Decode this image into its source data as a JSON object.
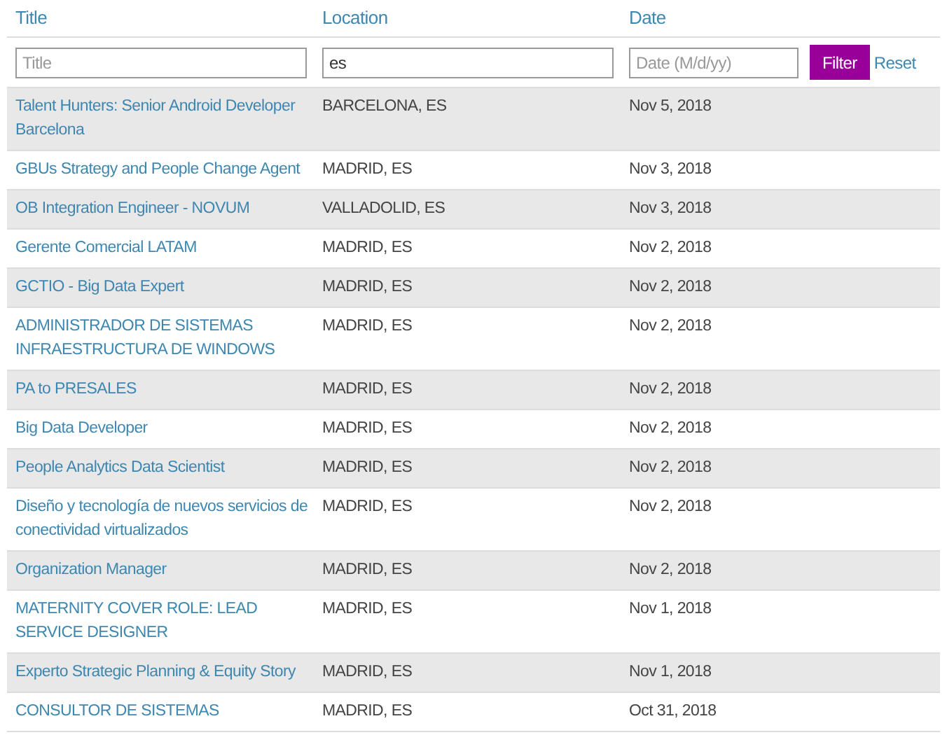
{
  "columns": [
    "Title",
    "Location",
    "Date"
  ],
  "filters": [
    {
      "placeholder": "Title"
    },
    {
      "value": "es"
    },
    {
      "placeholder": "Date (M/d/yy)"
    }
  ],
  "buttons": {
    "filter": "Filter",
    "reset": "Reset"
  },
  "rows": [
    {
      "title": "Talent Hunters: Senior Android Developer Barcelona",
      "location": "BARCELONA, ES",
      "date": "Nov 5, 2018"
    },
    {
      "title": "GBUs Strategy and People Change Agent",
      "location": "MADRID, ES",
      "date": "Nov 3, 2018"
    },
    {
      "title": "OB Integration Engineer - NOVUM",
      "location": "VALLADOLID, ES",
      "date": "Nov 3, 2018"
    },
    {
      "title": "Gerente Comercial LATAM",
      "location": "MADRID, ES",
      "date": "Nov 2, 2018"
    },
    {
      "title": "GCTIO - Big Data Expert",
      "location": "MADRID, ES",
      "date": "Nov 2, 2018"
    },
    {
      "title": "ADMINISTRADOR DE SISTEMAS INFRAESTRUCTURA DE WINDOWS",
      "location": "MADRID, ES",
      "date": "Nov 2, 2018"
    },
    {
      "title": "PA to PRESALES",
      "location": "MADRID, ES",
      "date": "Nov 2, 2018"
    },
    {
      "title": "Big Data Developer",
      "location": "MADRID, ES",
      "date": "Nov 2, 2018"
    },
    {
      "title": "People Analytics Data Scientist",
      "location": "MADRID, ES",
      "date": "Nov 2, 2018"
    },
    {
      "title": "Diseño y tecnología de nuevos servicios de conectividad virtualizados",
      "location": "MADRID, ES",
      "date": "Nov 2, 2018"
    },
    {
      "title": "Organization Manager",
      "location": "MADRID, ES",
      "date": "Nov 2, 2018"
    },
    {
      "title": "MATERNITY COVER ROLE: LEAD SERVICE DESIGNER",
      "location": "MADRID, ES",
      "date": "Nov 1, 2018"
    },
    {
      "title": "Experto Strategic Planning & Equity Story",
      "location": "MADRID, ES",
      "date": "Nov 1, 2018"
    },
    {
      "title": "CONSULTOR DE SISTEMAS",
      "location": "MADRID, ES",
      "date": "Oct 31, 2018"
    }
  ]
}
